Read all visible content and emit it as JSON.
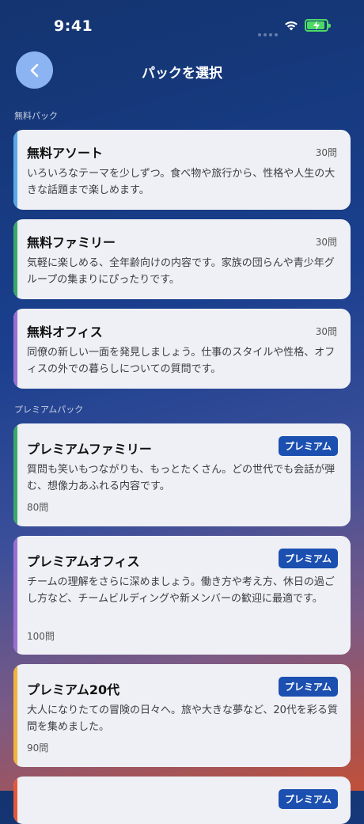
{
  "status_bar": {
    "time": "9:41"
  },
  "header": {
    "title": "パックを選択",
    "back_icon": "chevron-left-icon"
  },
  "sections": [
    {
      "label": "無料パック"
    },
    {
      "label": "プレミアムパック"
    }
  ],
  "free_packs": [
    {
      "title": "無料アソート",
      "count": "30問",
      "description": "いろいろなテーマを少しずつ。食べ物や旅行から、性格や人生の大きな話題まで楽しめます。",
      "accent": "#5aa9e6"
    },
    {
      "title": "無料ファミリー",
      "count": "30問",
      "description": "気軽に楽しめる、全年齢向けの内容です。家族の団らんや青少年グループの集まりにぴったりです。",
      "accent": "#3aa86b"
    },
    {
      "title": "無料オフィス",
      "count": "30問",
      "description": "同僚の新しい一面を発見しましょう。仕事のスタイルや性格、オフィスの外での暮らしについての質問です。",
      "accent": "#9a6fd0"
    }
  ],
  "premium_packs": [
    {
      "title": "プレミアムファミリー",
      "badge": "プレミアム",
      "description": "質問も笑いもつながりも、もっとたくさん。どの世代でも会話が弾む、想像力あふれる内容です。",
      "count": "80問",
      "accent": "#3aa86b"
    },
    {
      "title": "プレミアムオフィス",
      "badge": "プレミアム",
      "description": "チームの理解をさらに深めましょう。働き方や考え方、休日の過ごし方など、チームビルディングや新メンバーの歓迎に最適です。",
      "count": "100問",
      "accent": "#9a6fd0"
    },
    {
      "title": "プレミアム20代",
      "badge": "プレミアム",
      "description": "大人になりたての冒険の日々へ。旅や大きな夢など、20代を彩る質問を集めました。",
      "count": "90問",
      "accent": "#f0b43c"
    },
    {
      "title": "",
      "badge": "プレミアム",
      "description": "",
      "count": "",
      "accent": "#e2583c"
    }
  ],
  "colors": {
    "badge_bg": "#1b4fb0",
    "battery": "#4cd964",
    "back_button": "#8db4f2"
  }
}
